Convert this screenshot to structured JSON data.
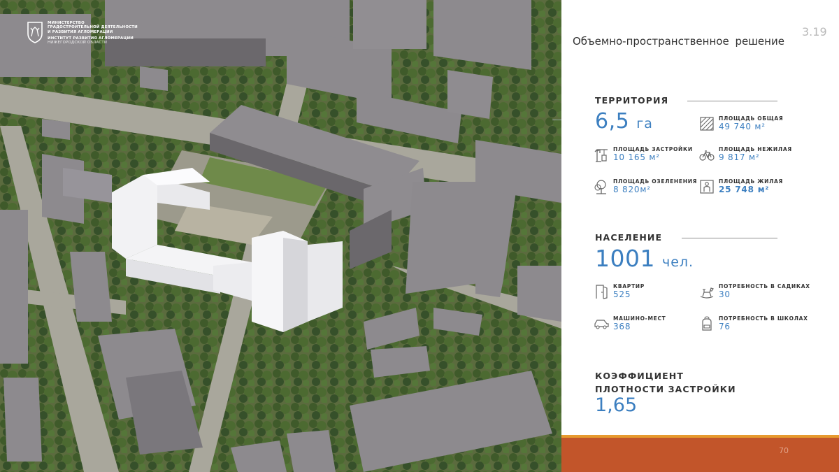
{
  "logo": {
    "line1": "Министерство",
    "line2": "градостроительной деятельности",
    "line3": "и развития агломерации",
    "line4": "Институт развития агломерации",
    "line5": "Нижегородской области"
  },
  "title": "Объемно-пространственное решение",
  "slide_number": "3.19",
  "page_number": "70",
  "territory": {
    "heading": "ТЕРРИТОРИЯ",
    "value": "6,5",
    "unit": "га",
    "stats": [
      {
        "icon": "hatched-square-icon",
        "label": "ПЛОЩАДЬ ОБЩАЯ",
        "value": "49 740 м²"
      },
      {
        "icon": "crane-icon",
        "label": "ПЛОЩАДЬ ЗАСТРОЙКИ",
        "value": "10 165 м²"
      },
      {
        "icon": "bicycle-icon",
        "label": "ПЛОЩАДЬ НЕЖИЛАЯ",
        "value": "9 817 м²"
      },
      {
        "icon": "tree-icon",
        "label": "ПЛОЩАДЬ ОЗЕЛЕНЕНИЯ",
        "value": "8 820м²"
      },
      {
        "icon": "person-in-frame-icon",
        "label": "ПЛОЩАДЬ ЖИЛАЯ",
        "value": "25 748 м²"
      }
    ]
  },
  "population": {
    "heading": "НАСЕЛЕНИЕ",
    "value": "1001",
    "unit": "чел.",
    "stats": [
      {
        "icon": "door-icon",
        "label": "КВАРТИР",
        "value": "525"
      },
      {
        "icon": "rocking-horse-icon",
        "label": "ПОТРЕБНОСТЬ В САДИКАХ",
        "value": "30"
      },
      {
        "icon": "car-icon",
        "label": "МАШИНО-МЕСТ",
        "value": "368"
      },
      {
        "icon": "backpack-icon",
        "label": "ПОТРЕБНОСТЬ В ШКОЛАХ",
        "value": "76"
      }
    ]
  },
  "coefficient": {
    "heading_line1": "КОЭФФИЦИЕНТ",
    "heading_line2": "ПЛОТНОСТИ ЗАСТРОЙКИ",
    "value": "1,65"
  },
  "colors": {
    "accent": "#3c7fc0",
    "footer_bar": "#c2552a",
    "footer_stripe": "#e79a2f"
  }
}
